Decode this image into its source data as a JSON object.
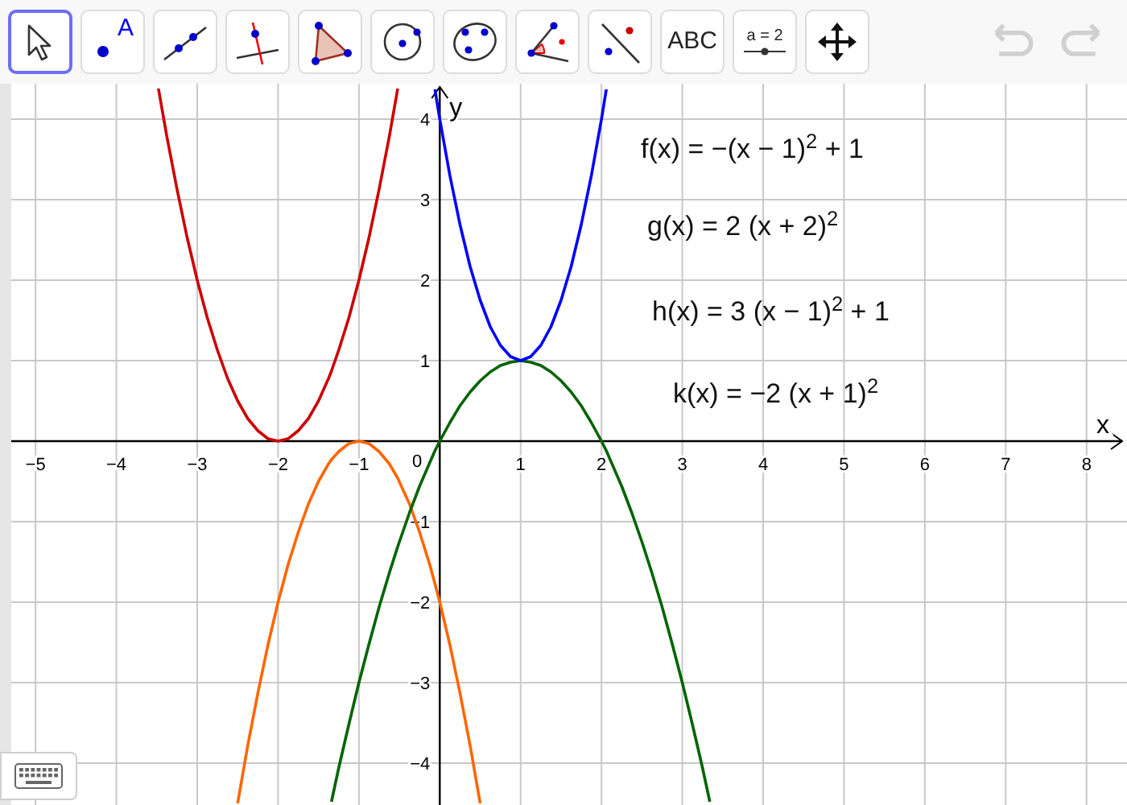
{
  "toolbar": {
    "tools": [
      {
        "kind": "move",
        "selected": true
      },
      {
        "kind": "point",
        "label": "A",
        "selected": false
      },
      {
        "kind": "line",
        "selected": false
      },
      {
        "kind": "perpendicular",
        "selected": false
      },
      {
        "kind": "polygon",
        "selected": false
      },
      {
        "kind": "circle",
        "selected": false
      },
      {
        "kind": "conic",
        "selected": false
      },
      {
        "kind": "angle",
        "selected": false
      },
      {
        "kind": "reflect",
        "selected": false
      },
      {
        "kind": "text",
        "label": "ABC",
        "selected": false
      },
      {
        "kind": "slider",
        "label": "a = 2",
        "selected": false
      },
      {
        "kind": "pan",
        "selected": false
      }
    ],
    "undo": {
      "disabled": true
    },
    "redo": {
      "disabled": true
    }
  },
  "graphics": {
    "chart_data": {
      "type": "line",
      "grid": true,
      "xlabel": "x",
      "ylabel": "y",
      "xlim": [
        -5.3,
        8.5
      ],
      "ylim": [
        -4.52,
        4.44
      ],
      "xticks": [
        {
          "value": -5,
          "label": "−5"
        },
        {
          "value": -4,
          "label": "−4"
        },
        {
          "value": -3,
          "label": "−3"
        },
        {
          "value": -2,
          "label": "−2"
        },
        {
          "value": -1,
          "label": "−1"
        },
        1,
        2,
        3,
        4,
        5,
        6,
        7,
        8
      ],
      "yticks": [
        {
          "value": -4,
          "label": "−4"
        },
        {
          "value": -3,
          "label": "−3"
        },
        {
          "value": -2,
          "label": "−2"
        },
        {
          "value": -1,
          "label": "−1"
        },
        1,
        2,
        3,
        4
      ],
      "x": [
        -3.48,
        -3.375,
        -3.25,
        -3.125,
        -3,
        -2.875,
        -2.75,
        -2.625,
        -2.5,
        -2.375,
        -2.25,
        -2.125,
        -2,
        -1.875,
        -1.75,
        -1.625,
        -1.5,
        -1.375,
        -1.34,
        -1.25,
        -1.125,
        -1,
        -0.875,
        -0.75,
        -0.625,
        -0.52,
        -0.375,
        -0.25,
        -0.125,
        -0.06,
        0,
        0.125,
        0.25,
        0.375,
        0.5,
        0.625,
        0.75,
        0.875,
        1,
        1.125,
        1.25,
        1.375,
        1.5,
        1.625,
        1.75,
        1.875,
        2,
        2.06,
        2.125,
        2.25,
        2.375,
        2.5,
        2.625,
        2.75,
        2.875,
        3,
        3.125,
        3.25,
        3.34
      ],
      "series": [
        {
          "color": "#cc0000",
          "values": [
            4.38,
            3.78,
            3.13,
            2.53,
            2,
            1.53,
            1.13,
            0.78,
            0.5,
            0.28,
            0.13,
            0.03,
            0,
            0.03,
            0.13,
            0.28,
            0.5,
            0.78,
            0.87,
            1.13,
            1.53,
            2,
            2.53,
            3.13,
            3.78,
            4.38,
            null,
            null,
            null,
            null,
            null,
            null,
            null,
            null,
            null,
            null,
            null,
            null,
            null,
            null,
            null,
            null,
            null,
            null,
            null,
            null,
            null,
            null,
            null,
            null,
            null,
            null,
            null,
            null,
            null,
            null,
            null,
            null,
            null
          ]
        },
        {
          "color": "#ff6600",
          "values": [
            null,
            null,
            null,
            null,
            null,
            null,
            null,
            null,
            -4.5,
            -3.78,
            -3.13,
            -2.53,
            -2,
            -1.53,
            -1.13,
            -0.78,
            -0.5,
            -0.28,
            -0.23,
            -0.13,
            -0.03,
            0,
            -0.03,
            -0.13,
            -0.28,
            -0.46,
            -0.78,
            -1.13,
            -1.53,
            -1.77,
            -2,
            -2.53,
            -3.13,
            -3.78,
            -4.5,
            null,
            null,
            null,
            null,
            null,
            null,
            null,
            null,
            null,
            null,
            null,
            null,
            null,
            null,
            null,
            null,
            null,
            null,
            null,
            null,
            null,
            null,
            null,
            null
          ]
        },
        {
          "color": "#006400",
          "values": [
            null,
            null,
            null,
            null,
            null,
            null,
            null,
            null,
            null,
            null,
            null,
            null,
            null,
            null,
            null,
            null,
            null,
            null,
            -4.48,
            -4.06,
            -3.52,
            -3,
            -2.52,
            -2.06,
            -1.64,
            -1.31,
            -0.89,
            -0.56,
            -0.27,
            -0.12,
            0,
            0.23,
            0.44,
            0.61,
            0.75,
            0.86,
            0.94,
            0.98,
            1,
            0.98,
            0.94,
            0.86,
            0.75,
            0.61,
            0.44,
            0.23,
            0,
            -0.12,
            -0.27,
            -0.56,
            -0.89,
            -1.25,
            -1.64,
            -2.06,
            -2.52,
            -3,
            -3.52,
            -4.06,
            -4.48
          ]
        },
        {
          "color": "#0000ff",
          "values": [
            null,
            null,
            null,
            null,
            null,
            null,
            null,
            null,
            null,
            null,
            null,
            null,
            null,
            null,
            null,
            null,
            null,
            null,
            null,
            null,
            null,
            null,
            null,
            null,
            null,
            null,
            null,
            null,
            null,
            4.37,
            4,
            3.3,
            2.69,
            2.17,
            1.75,
            1.42,
            1.19,
            1.05,
            1,
            1.05,
            1.19,
            1.42,
            1.75,
            2.17,
            2.69,
            3.3,
            4,
            4.37,
            null,
            null,
            null,
            null,
            null,
            null,
            null,
            null,
            null,
            null,
            null
          ]
        }
      ]
    },
    "origin_label": "0",
    "formulas": [
      "f(x) = −(x − 1)$^{2}$ + 1",
      "g(x) = 2 (x + 2)$^{2}$",
      "h(x) = 3 (x − 1)$^{2}$ + 1",
      "k(x) = −2 (x + 1)$^{2}$"
    ]
  },
  "keyboard_button": {
    "disabled": false
  }
}
